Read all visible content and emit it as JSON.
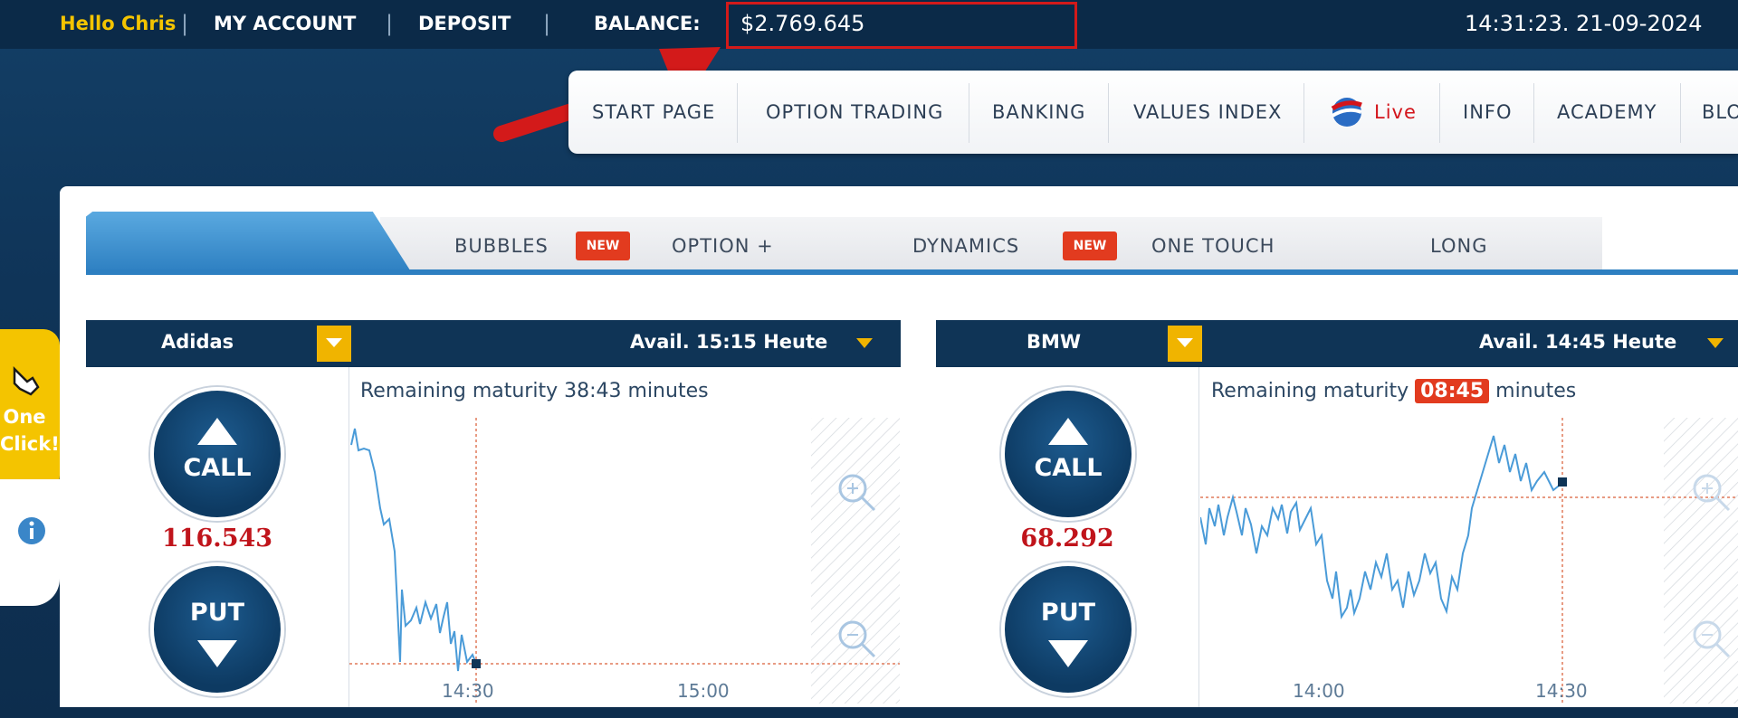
{
  "topbar": {
    "greeting": "Hello Chris",
    "my_account": "MY ACCOUNT",
    "deposit": "DEPOSIT",
    "balance_label": "BALANCE:",
    "balance_value": "$2.769.645",
    "clock": "14:31:23. 21-09-2024",
    "separator": "|"
  },
  "nav": {
    "items": [
      "START PAGE",
      "OPTION TRADING",
      "BANKING",
      "VALUES INDEX",
      "Live",
      "INFO",
      "ACADEMY",
      "BLO"
    ]
  },
  "side": {
    "one_click": "One Click!",
    "info_icon": "info-icon"
  },
  "tabs": {
    "items": [
      "BUBBLES",
      "OPTION +",
      "DYNAMICS",
      "ONE TOUCH",
      "LONG"
    ],
    "badge": "NEW"
  },
  "assets": [
    {
      "name": "Adidas",
      "avail": "Avail.  15:15 Heute",
      "call": "CALL",
      "put": "PUT",
      "price": "116.543",
      "remaining_prefix": "Remaining maturity",
      "remaining_value": "38:43",
      "remaining_suffix": "minutes",
      "x_ticks": [
        "14:30",
        "15:00"
      ]
    },
    {
      "name": "BMW",
      "avail": "Avail.  14:45 Heute",
      "call": "CALL",
      "put": "PUT",
      "price": "68.292",
      "remaining_prefix": "Remaining maturity",
      "remaining_value": "08:45",
      "remaining_suffix": "minutes",
      "x_ticks": [
        "14:00",
        "14:30"
      ]
    }
  ],
  "colors": {
    "accent": "#f0b400",
    "navy": "#0f3456",
    "price_red": "#c0141b",
    "badge_red": "#e23b1f",
    "line_blue": "#4a9bd8"
  }
}
